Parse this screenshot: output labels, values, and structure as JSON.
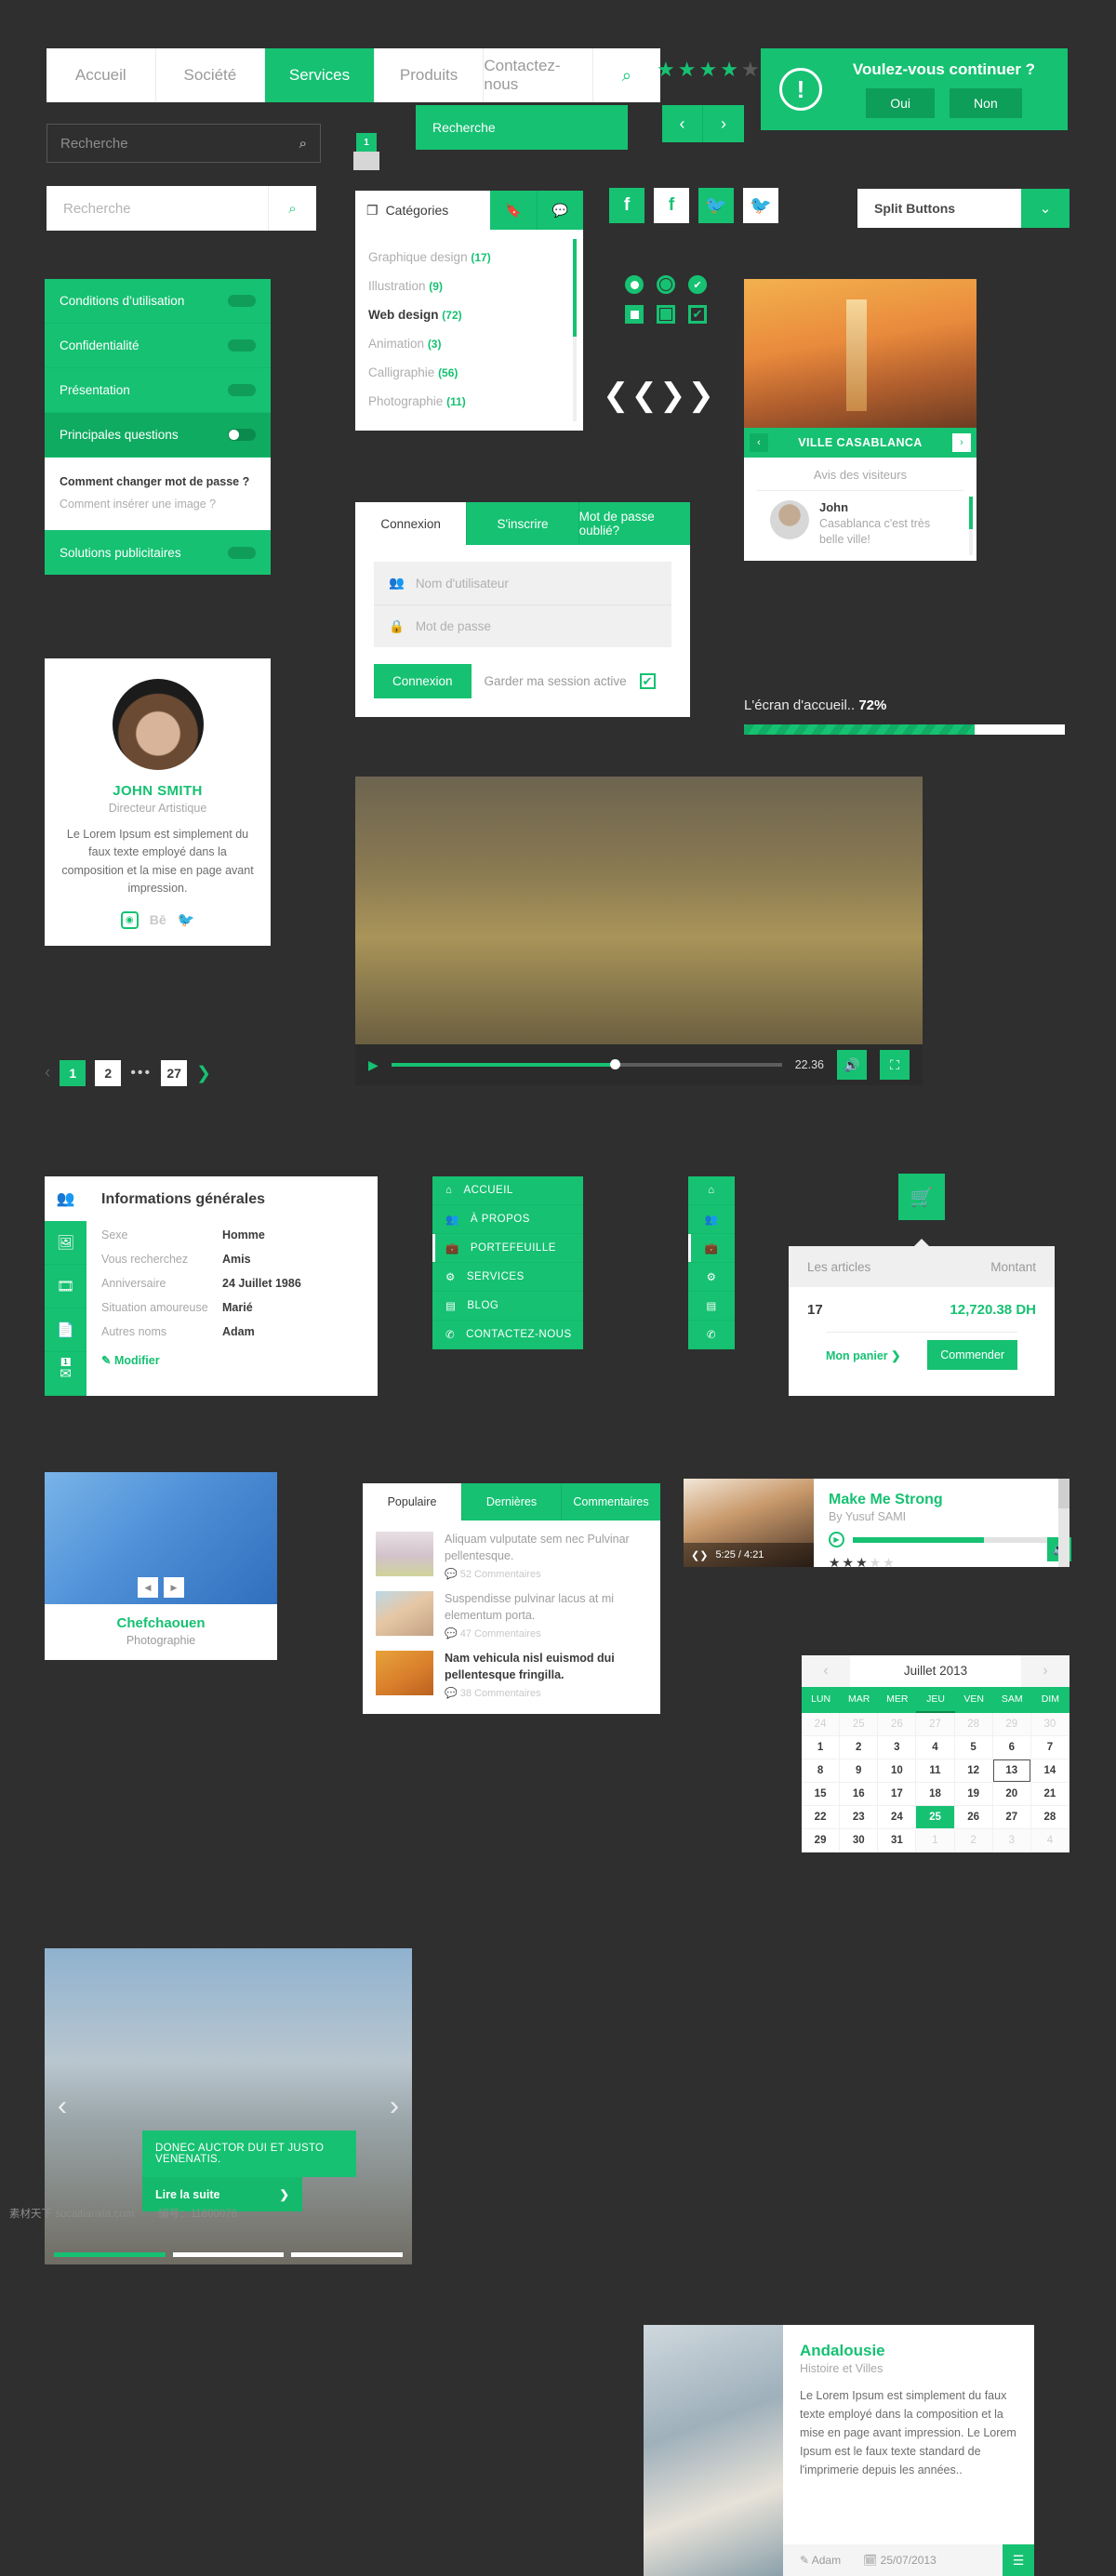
{
  "topnav": {
    "items": [
      {
        "label": "Accueil",
        "active": false
      },
      {
        "label": "Société",
        "active": false
      },
      {
        "label": "Services",
        "active": true
      },
      {
        "label": "Produits",
        "active": false
      },
      {
        "label": "Contactez-nous",
        "active": false
      }
    ],
    "search_icon": "search-icon"
  },
  "search": {
    "dark_placeholder": "Recherche",
    "white_placeholder": "Recherche",
    "green_label": "Recherche",
    "badge": "1"
  },
  "rating": {
    "filled": 4,
    "total": 5
  },
  "arrows": {
    "prev": "‹",
    "next": "›"
  },
  "alert": {
    "title": "Voulez-vous continuer ?",
    "yes": "Oui",
    "no": "Non",
    "icon": "exclamation-icon"
  },
  "categories": {
    "title": "Catégories",
    "icon": "layers-icon",
    "tab_icons": [
      "bookmark-icon",
      "comment-icon"
    ],
    "items": [
      {
        "label": "Graphique design",
        "count": "(17)",
        "active": false
      },
      {
        "label": "Illustration",
        "count": "(9)",
        "active": false
      },
      {
        "label": "Web design",
        "count": "(72)",
        "active": true
      },
      {
        "label": "Animation",
        "count": "(3)",
        "active": false
      },
      {
        "label": "Calligraphie",
        "count": "(56)",
        "active": false
      },
      {
        "label": "Photographie",
        "count": "(11)",
        "active": false
      }
    ]
  },
  "accordion": {
    "items": [
      {
        "label": "Conditions d’utilisation",
        "on": false
      },
      {
        "label": "Confidentialité",
        "on": false
      },
      {
        "label": "Présentation",
        "on": false
      },
      {
        "label": "Principales questions",
        "on": true
      }
    ],
    "panel": [
      {
        "label": "Comment changer mot de passe ?",
        "bold": true
      },
      {
        "label": "Comment insérer une image ?",
        "bold": false
      }
    ],
    "last": {
      "label": "Solutions publicitaires",
      "on": false
    }
  },
  "login": {
    "tabs": [
      {
        "label": "Connexion",
        "active": true
      },
      {
        "label": "S'inscrire",
        "active": false
      },
      {
        "label": "Mot de passe oublié?",
        "active": false
      }
    ],
    "user_placeholder": "Nom d'utilisateur",
    "pass_placeholder": "Mot de passe",
    "submit": "Connexion",
    "keep": "Garder ma session active",
    "check": "✔"
  },
  "social": {
    "facebook": "f",
    "twitter": "🐦"
  },
  "split_button": {
    "label": "Split Buttons",
    "caret": "❯"
  },
  "casablanca": {
    "title": "VILLE CASABLANCA",
    "prev": "‹",
    "next": "›",
    "reviews_title": "Avis des visiteurs",
    "review": {
      "name": "John",
      "text": "Casablanca c'est très belle ville!"
    }
  },
  "progress": {
    "label": "L'écran d'accueil..",
    "value": "72%",
    "percent": 72
  },
  "profile": {
    "name": "JOHN SMITH",
    "role": "Directeur Artistique",
    "bio": "Le Lorem Ipsum est simplement du faux texte employé dans la composition et la mise en page avant impression.",
    "socials": [
      "instagram-icon",
      "behance-icon",
      "twitter-icon"
    ],
    "behance": "Bē"
  },
  "pagination": {
    "prev": "‹",
    "next": "❯",
    "pages": [
      "1",
      "2",
      "27"
    ],
    "current": "1",
    "ellipsis": "•••"
  },
  "video": {
    "play": "▶",
    "time": "22.36",
    "volume": "🔊",
    "fullscreen": "⛶",
    "progress": 56
  },
  "info_panel": {
    "title": "Informations générales",
    "header_icon": "users-icon",
    "rail_icons": [
      "image-icon",
      "film-icon",
      "file-icon",
      "mail-icon"
    ],
    "mail_badge": "1",
    "rows": [
      {
        "key": "Sexe",
        "value": "Homme"
      },
      {
        "key": "Vous recherchez",
        "value": "Amis"
      },
      {
        "key": "Anniversaire",
        "value": "24 Juillet 1986"
      },
      {
        "key": "Situation amoureuse",
        "value": "Marié"
      },
      {
        "key": "Autres noms",
        "value": "Adam"
      }
    ],
    "edit": "Modifier"
  },
  "vmenu": {
    "items": [
      {
        "label": "ACCUEIL",
        "icon": "home-icon",
        "active": false
      },
      {
        "label": "À PROPOS",
        "icon": "users-icon",
        "active": false
      },
      {
        "label": "PORTEFEUILLE",
        "icon": "briefcase-icon",
        "active": true
      },
      {
        "label": "SERVICES",
        "icon": "gear-icon",
        "active": false
      },
      {
        "label": "BLOG",
        "icon": "list-icon",
        "active": false
      },
      {
        "label": "CONTACTEZ-NOUS",
        "icon": "phone-icon",
        "active": false
      }
    ]
  },
  "cart": {
    "button_icon": "cart-icon",
    "col_items": "Les articles",
    "col_amount": "Montant",
    "qty": "17",
    "amount": "12,720.38 DH",
    "my_cart": "Mon panier",
    "checkout": "Commender"
  },
  "chefchaouen": {
    "title": "Chefchaouen",
    "subtitle": "Photographie",
    "prev": "◀",
    "next": "▶"
  },
  "posts": {
    "tabs": [
      {
        "label": "Populaire",
        "active": true
      },
      {
        "label": "Dernières",
        "active": false
      },
      {
        "label": "Commentaires",
        "active": false
      }
    ],
    "items": [
      {
        "text": "Aliquam vulputate sem nec Pulvinar pellentesque.",
        "comments": "52 Commentaires",
        "bold": false
      },
      {
        "text": "Suspendisse pulvinar lacus at mi elementum porta.",
        "comments": "47 Commentaires",
        "bold": false
      },
      {
        "text": "Nam vehicula nisl euismod dui pellentesque fringilla.",
        "comments": "38 Commentaires",
        "bold": true
      }
    ]
  },
  "audio": {
    "title": "Make Me Strong",
    "by": "By Yusuf SAMI",
    "time": "5:25 / 4:21",
    "progress": 65,
    "stars_filled": 3,
    "stars_total": 5
  },
  "calendar": {
    "month": "Juillet 2013",
    "prev": "‹",
    "next": "›",
    "dow": [
      "LUN",
      "MAR",
      "MER",
      "JEU",
      "VEN",
      "SAM",
      "DIM"
    ],
    "dow_active": "JEU",
    "weeks": [
      [
        {
          "d": "24",
          "m": true
        },
        {
          "d": "25",
          "m": true
        },
        {
          "d": "26",
          "m": true
        },
        {
          "d": "27",
          "m": true
        },
        {
          "d": "28",
          "m": true
        },
        {
          "d": "29",
          "m": true
        },
        {
          "d": "30",
          "m": true
        }
      ],
      [
        {
          "d": "1"
        },
        {
          "d": "2"
        },
        {
          "d": "3"
        },
        {
          "d": "4"
        },
        {
          "d": "5"
        },
        {
          "d": "6"
        },
        {
          "d": "7"
        }
      ],
      [
        {
          "d": "8"
        },
        {
          "d": "9"
        },
        {
          "d": "10"
        },
        {
          "d": "11"
        },
        {
          "d": "12"
        },
        {
          "d": "13",
          "today": true
        },
        {
          "d": "14"
        }
      ],
      [
        {
          "d": "15"
        },
        {
          "d": "16"
        },
        {
          "d": "17"
        },
        {
          "d": "18"
        },
        {
          "d": "19"
        },
        {
          "d": "20"
        },
        {
          "d": "21"
        }
      ],
      [
        {
          "d": "22"
        },
        {
          "d": "23"
        },
        {
          "d": "24"
        },
        {
          "d": "25",
          "sel": true
        },
        {
          "d": "26"
        },
        {
          "d": "27"
        },
        {
          "d": "28"
        }
      ],
      [
        {
          "d": "29"
        },
        {
          "d": "30"
        },
        {
          "d": "31"
        },
        {
          "d": "1",
          "m": true
        },
        {
          "d": "2",
          "m": true
        },
        {
          "d": "3",
          "m": true
        },
        {
          "d": "4",
          "m": true
        }
      ]
    ]
  },
  "hero": {
    "caption": "DONEC AUCTOR DUI ET JUSTO VENENATIS.",
    "button": "Lire la suite",
    "arrow": "❯",
    "prev": "‹",
    "next": "›",
    "slides": 3,
    "active": 1
  },
  "article": {
    "title": "Andalousie",
    "subtitle": "Histoire et Villes",
    "body": "Le Lorem Ipsum est simplement du faux texte employé dans la composition et la mise en page avant impression. Le Lorem Ipsum est le faux texte standard de l'imprimerie depuis les années..",
    "author": "Adam",
    "date": "25/07/2013",
    "menu_icon": "hamburger-icon"
  },
  "footer": {
    "site": "素材天下 sucaitianxia.com",
    "number": "编号：11800076"
  },
  "colors": {
    "green": "#16c172",
    "green_dark": "#0faf62",
    "bg": "#2f2f2f"
  }
}
